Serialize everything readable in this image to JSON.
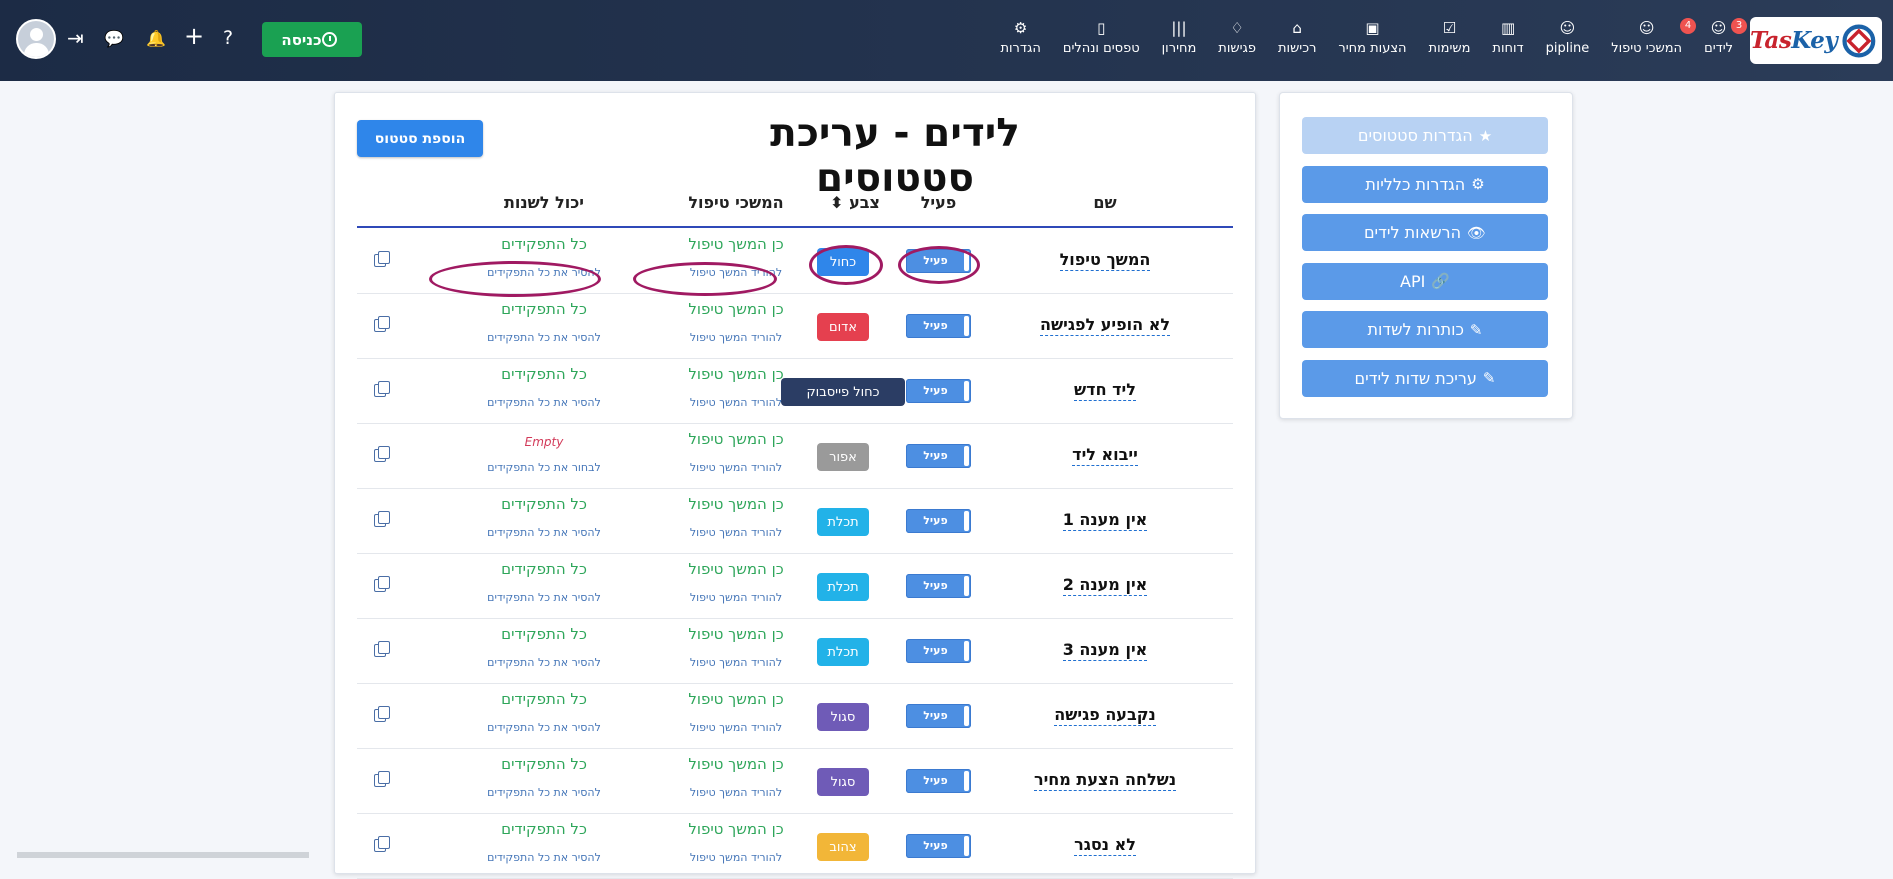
{
  "navbar": {
    "logo": {
      "text_red": "Tas",
      "text_blue": "Key"
    },
    "items": [
      {
        "label": "לידים",
        "icon": "users-icon",
        "glyph": "☺",
        "badge": "3"
      },
      {
        "label": "המשכי טיפול",
        "icon": "users-icon",
        "glyph": "☺",
        "badge": "4"
      },
      {
        "label": "pipline",
        "icon": "pipeline-icon",
        "glyph": "☺",
        "badge": ""
      },
      {
        "label": "דוחות",
        "icon": "chart-icon",
        "glyph": "▥",
        "badge": ""
      },
      {
        "label": "משימות",
        "icon": "checkbox-icon",
        "glyph": "☑",
        "badge": ""
      },
      {
        "label": "הצעות מחיר",
        "icon": "quote-icon",
        "glyph": "▣",
        "badge": ""
      },
      {
        "label": "רכישות",
        "icon": "factory-icon",
        "glyph": "⌂",
        "badge": ""
      },
      {
        "label": "פגישות",
        "icon": "handshake-icon",
        "glyph": "♢",
        "badge": ""
      },
      {
        "label": "מחירון",
        "icon": "barcode-icon",
        "glyph": "|||",
        "badge": ""
      },
      {
        "label": "טפסים ונהלים",
        "icon": "file-icon",
        "glyph": "▯",
        "badge": ""
      },
      {
        "label": "הגדרות",
        "icon": "gear-icon",
        "glyph": "⚙",
        "badge": ""
      }
    ],
    "enter_button": "כניסה",
    "top_icons": {
      "question": "?",
      "plus": "+",
      "bell": "🔔",
      "chat": "💬",
      "signin": "⇥"
    }
  },
  "side_panel": {
    "buttons": [
      {
        "label": "הגדרות סטטוסים",
        "glyph": "★",
        "icon": "star-icon",
        "disabled": true
      },
      {
        "label": "הגדרות כלליות",
        "glyph": "⚙",
        "icon": "gear-icon",
        "disabled": false
      },
      {
        "label": "הרשאות לידים",
        "glyph": "👁",
        "icon": "eye-slash-icon",
        "disabled": false
      },
      {
        "label": "API",
        "glyph": "🔗",
        "icon": "link-icon",
        "disabled": false
      },
      {
        "label": "כותרות לשדות",
        "glyph": "✎",
        "icon": "edit-icon",
        "disabled": false
      },
      {
        "label": "עריכת שדות לידים",
        "glyph": "✎",
        "icon": "edit-icon",
        "disabled": false
      }
    ]
  },
  "main": {
    "title": "לידים - עריכת סטטוסים",
    "add_status_button": "הוספת סטטוס",
    "headers": {
      "name": "שם",
      "active": "פעיל",
      "color": "צבע",
      "continuations": "המשכי טיפול",
      "can_change": "יכול לשנות"
    },
    "sort_glyph": "⬍",
    "rows": [
      {
        "name": "המשך טיפול",
        "active": "פעיל",
        "color_label": "כחול",
        "color_hex": "#2f86ea",
        "perm_main": "כן המשך טיפול",
        "perm_sub": "להוריד המשך טיפול",
        "role_main": "כל התפקידים",
        "role_sub": "להסיר את כל התפקידים",
        "role_empty": false
      },
      {
        "name": "לא הופיע לפגישה",
        "active": "פעיל",
        "color_label": "אדום",
        "color_hex": "#e5404f",
        "perm_main": "כן המשך טיפול",
        "perm_sub": "להוריד המשך טיפול",
        "role_main": "כל התפקידים",
        "role_sub": "להסיר את כל התפקידים",
        "role_empty": false
      },
      {
        "name": "ליד חדש",
        "active": "פעיל",
        "color_label": "כחול פייסבוק",
        "color_hex": "#2b3d64",
        "perm_main": "כן המשך טיפול",
        "perm_sub": "להוריד המשך טיפול",
        "role_main": "כל התפקידים",
        "role_sub": "להסיר את כל התפקידים",
        "role_empty": false
      },
      {
        "name": "ייבוא ליד",
        "active": "פעיל",
        "color_label": "אפור",
        "color_hex": "#9a9a9a",
        "perm_main": "כן המשך טיפול",
        "perm_sub": "להוריד המשך טיפול",
        "role_main": "Empty",
        "role_sub": "לבחור את כל התפקידים",
        "role_empty": true
      },
      {
        "name": "אין מענה 1",
        "active": "פעיל",
        "color_label": "תכלת",
        "color_hex": "#22b2e8",
        "perm_main": "כן המשך טיפול",
        "perm_sub": "להוריד המשך טיפול",
        "role_main": "כל התפקידים",
        "role_sub": "להסיר את כל התפקידים",
        "role_empty": false
      },
      {
        "name": "אין מענה 2",
        "active": "פעיל",
        "color_label": "תכלת",
        "color_hex": "#22b2e8",
        "perm_main": "כן המשך טיפול",
        "perm_sub": "להוריד המשך טיפול",
        "role_main": "כל התפקידים",
        "role_sub": "להסיר את כל התפקידים",
        "role_empty": false
      },
      {
        "name": "אין מענה 3",
        "active": "פעיל",
        "color_label": "תכלת",
        "color_hex": "#22b2e8",
        "perm_main": "כן המשך טיפול",
        "perm_sub": "להוריד המשך טיפול",
        "role_main": "כל התפקידים",
        "role_sub": "להסיר את כל התפקידים",
        "role_empty": false
      },
      {
        "name": "נקבעה פגישה",
        "active": "פעיל",
        "color_label": "סגול",
        "color_hex": "#6f5bb7",
        "perm_main": "כן המשך טיפול",
        "perm_sub": "להוריד המשך טיפול",
        "role_main": "כל התפקידים",
        "role_sub": "להסיר את כל התפקידים",
        "role_empty": false
      },
      {
        "name": "נשלחה הצעת מחיר",
        "active": "פעיל",
        "color_label": "סגול",
        "color_hex": "#6f5bb7",
        "perm_main": "כן המשך טיפול",
        "perm_sub": "להוריד המשך טיפול",
        "role_main": "כל התפקידים",
        "role_sub": "להסיר את כל התפקידים",
        "role_empty": false
      },
      {
        "name": "לא נסגר",
        "active": "פעיל",
        "color_label": "צהוב",
        "color_hex": "#f2b638",
        "perm_main": "כן המשך טיפול",
        "perm_sub": "להוריד המשך טיפול",
        "role_main": "כל התפקידים",
        "role_sub": "להסיר את כל התפקידים",
        "role_empty": false
      }
    ]
  }
}
